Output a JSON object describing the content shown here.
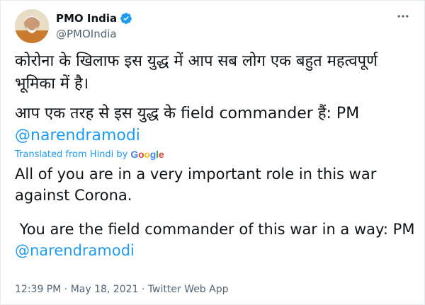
{
  "author": {
    "name": "PMO India",
    "handle": "@PMOIndia"
  },
  "tweet": {
    "hindi_line1": "कोरोना के खिलाफ इस युद्ध में आप सब लोग एक बहुत महत्वपूर्ण",
    "hindi_line2": "भूमिका में है।",
    "hindi_line3": "आप एक तरह से इस युद्ध के field commander हैं: PM",
    "hindi_mention": "@narendramodi",
    "translated_from": "Translated from Hindi by",
    "translator": "Google",
    "english_line1": "All of you are in a very important role in this war",
    "english_line2": "against Corona.",
    "english_line3": " You are the field commander of this war in a way: PM",
    "english_mention": "@narendramodi"
  },
  "meta": {
    "time": "12:39 PM",
    "date": "May 18, 2021",
    "source": "Twitter Web App",
    "separator": "·"
  },
  "colors": {
    "link": "#1d9bf0",
    "secondary_text": "#536471",
    "verified": "#1d9bf0"
  }
}
